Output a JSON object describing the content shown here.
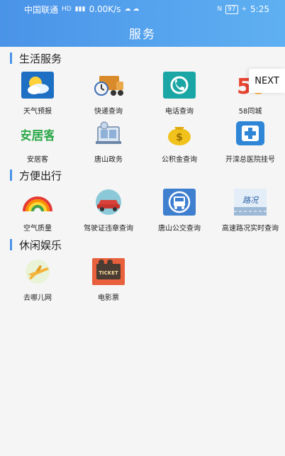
{
  "status": {
    "carrier": "中国联通",
    "net_speed": "0.00K/s",
    "battery": "97",
    "time": "5:25"
  },
  "header": {
    "title": "服务"
  },
  "floating": {
    "next_label": "NEXT"
  },
  "sections": [
    {
      "label": "生活服务",
      "items": [
        {
          "label": "天气预报",
          "icon": "weather-icon"
        },
        {
          "label": "快递查询",
          "icon": "delivery-truck-icon"
        },
        {
          "label": "电话查询",
          "icon": "phone-icon"
        },
        {
          "label": "58同城",
          "icon": "58-logo-icon"
        },
        {
          "label": "安居客",
          "icon": "anjuke-logo-icon",
          "logo_text": "安居客"
        },
        {
          "label": "唐山政务",
          "icon": "government-icon"
        },
        {
          "label": "公积金查询",
          "icon": "money-bag-icon"
        },
        {
          "label": "开滦总医院挂号",
          "icon": "hospital-icon"
        }
      ]
    },
    {
      "label": "方便出行",
      "items": [
        {
          "label": "空气质量",
          "icon": "rainbow-icon"
        },
        {
          "label": "驾驶证违章查询",
          "icon": "car-icon"
        },
        {
          "label": "唐山公交查询",
          "icon": "bus-icon"
        },
        {
          "label": "高速路况实时查询",
          "icon": "road-condition-icon",
          "logo_text": "路况"
        }
      ]
    },
    {
      "label": "休闲娱乐",
      "items": [
        {
          "label": "去哪儿网",
          "icon": "airplane-icon"
        },
        {
          "label": "电影票",
          "icon": "movie-ticket-icon",
          "logo_text": "TICKET"
        }
      ]
    }
  ]
}
